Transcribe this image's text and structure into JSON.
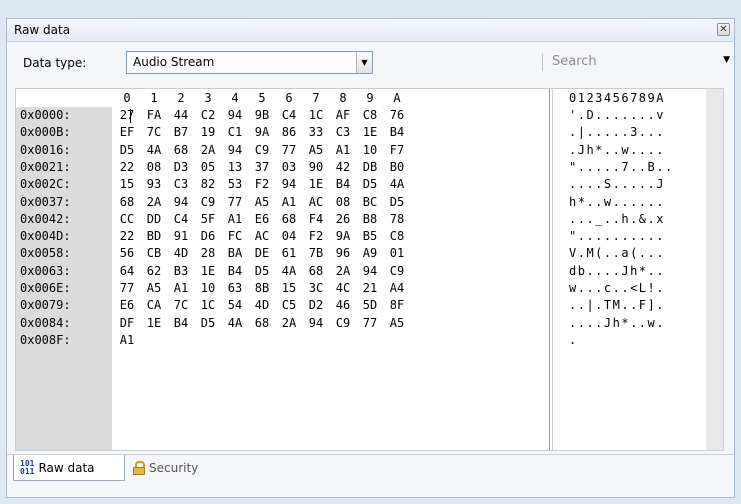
{
  "panel": {
    "title": "Raw data",
    "close_icon": "close-icon"
  },
  "toolbar": {
    "data_type_label": "Data type:",
    "data_type_value": "Audio Stream",
    "search_placeholder": "Search"
  },
  "hex": {
    "column_headers": [
      "0",
      "1",
      "2",
      "3",
      "4",
      "5",
      "6",
      "7",
      "8",
      "9",
      "A"
    ],
    "ascii_header": "0123456789A",
    "rows": [
      {
        "addr": "0x0000:",
        "bytes": [
          "27",
          "FA",
          "44",
          "C2",
          "94",
          "9B",
          "C4",
          "1C",
          "AF",
          "C8",
          "76"
        ],
        "ascii": "'.D.......v"
      },
      {
        "addr": "0x000B:",
        "bytes": [
          "EF",
          "7C",
          "B7",
          "19",
          "C1",
          "9A",
          "86",
          "33",
          "C3",
          "1E",
          "B4"
        ],
        "ascii": ".|.....3..."
      },
      {
        "addr": "0x0016:",
        "bytes": [
          "D5",
          "4A",
          "68",
          "2A",
          "94",
          "C9",
          "77",
          "A5",
          "A1",
          "10",
          "F7"
        ],
        "ascii": ".Jh*..w...."
      },
      {
        "addr": "0x0021:",
        "bytes": [
          "22",
          "08",
          "D3",
          "05",
          "13",
          "37",
          "03",
          "90",
          "42",
          "DB",
          "B0"
        ],
        "ascii": "\".....7..B.."
      },
      {
        "addr": "0x002C:",
        "bytes": [
          "15",
          "93",
          "C3",
          "82",
          "53",
          "F2",
          "94",
          "1E",
          "B4",
          "D5",
          "4A"
        ],
        "ascii": "....S.....J"
      },
      {
        "addr": "0x0037:",
        "bytes": [
          "68",
          "2A",
          "94",
          "C9",
          "77",
          "A5",
          "A1",
          "AC",
          "08",
          "BC",
          "D5"
        ],
        "ascii": "h*..w......"
      },
      {
        "addr": "0x0042:",
        "bytes": [
          "CC",
          "DD",
          "C4",
          "5F",
          "A1",
          "E6",
          "68",
          "F4",
          "26",
          "B8",
          "78"
        ],
        "ascii": "..._..h.&.x"
      },
      {
        "addr": "0x004D:",
        "bytes": [
          "22",
          "BD",
          "91",
          "D6",
          "FC",
          "AC",
          "04",
          "F2",
          "9A",
          "B5",
          "C8"
        ],
        "ascii": "\".........."
      },
      {
        "addr": "0x0058:",
        "bytes": [
          "56",
          "CB",
          "4D",
          "28",
          "BA",
          "DE",
          "61",
          "7B",
          "96",
          "A9",
          "01"
        ],
        "ascii": "V.M(..a(..."
      },
      {
        "addr": "0x0063:",
        "bytes": [
          "64",
          "62",
          "B3",
          "1E",
          "B4",
          "D5",
          "4A",
          "68",
          "2A",
          "94",
          "C9"
        ],
        "ascii": "db....Jh*.."
      },
      {
        "addr": "0x006E:",
        "bytes": [
          "77",
          "A5",
          "A1",
          "10",
          "63",
          "8B",
          "15",
          "3C",
          "4C",
          "21",
          "A4"
        ],
        "ascii": "w...c..<L!."
      },
      {
        "addr": "0x0079:",
        "bytes": [
          "E6",
          "CA",
          "7C",
          "1C",
          "54",
          "4D",
          "C5",
          "D2",
          "46",
          "5D",
          "8F"
        ],
        "ascii": "..|.TM..F]."
      },
      {
        "addr": "0x0084:",
        "bytes": [
          "DF",
          "1E",
          "B4",
          "D5",
          "4A",
          "68",
          "2A",
          "94",
          "C9",
          "77",
          "A5"
        ],
        "ascii": "....Jh*..w."
      },
      {
        "addr": "0x008F:",
        "bytes": [
          "A1"
        ],
        "ascii": "."
      }
    ]
  },
  "tabs": [
    {
      "label": "Raw data",
      "icon": "binary-icon",
      "icon_text": "101\n011",
      "active": true
    },
    {
      "label": "Security",
      "icon": "lock-icon",
      "active": false
    }
  ]
}
